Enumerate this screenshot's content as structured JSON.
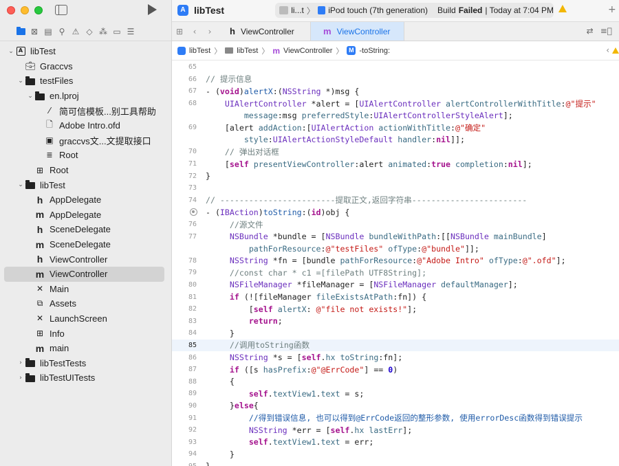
{
  "window": {
    "app_title": "libTest",
    "scheme": "li...t",
    "device": "iPod touch (7th generation)",
    "build_label": "Build",
    "build_status": "Failed",
    "build_time": "| Today at 7:04 PM"
  },
  "sidebar": {
    "tree": [
      {
        "label": "libTest",
        "icon": "project-icon",
        "depth": 0,
        "disclosure": "⌄"
      },
      {
        "label": "Graccvs",
        "icon": "briefcase-icon",
        "depth": 1,
        "disclosure": ""
      },
      {
        "label": "testFiles",
        "icon": "folder-icon",
        "depth": 1,
        "disclosure": "⌄"
      },
      {
        "label": "en.lproj",
        "icon": "folder-icon",
        "depth": 2,
        "disclosure": "⌄"
      },
      {
        "label": "简可信模板...别工具帮助",
        "icon": "pen-icon",
        "depth": 3,
        "disclosure": ""
      },
      {
        "label": "Adobe Intro.ofd",
        "icon": "document-icon",
        "depth": 3,
        "disclosure": ""
      },
      {
        "label": "graccvs文...文提取接口",
        "icon": "image-icon",
        "depth": 3,
        "disclosure": ""
      },
      {
        "label": "Root",
        "icon": "strings-icon",
        "depth": 3,
        "disclosure": ""
      },
      {
        "label": "Root",
        "icon": "table-icon",
        "depth": 2,
        "disclosure": ""
      },
      {
        "label": "libTest",
        "icon": "folder-icon",
        "depth": 1,
        "disclosure": "⌄"
      },
      {
        "label": "AppDelegate",
        "icon": "header-icon",
        "depth": 2,
        "disclosure": ""
      },
      {
        "label": "AppDelegate",
        "icon": "implementation-icon",
        "depth": 2,
        "disclosure": ""
      },
      {
        "label": "SceneDelegate",
        "icon": "header-icon",
        "depth": 2,
        "disclosure": ""
      },
      {
        "label": "SceneDelegate",
        "icon": "implementation-icon",
        "depth": 2,
        "disclosure": ""
      },
      {
        "label": "ViewController",
        "icon": "header-icon",
        "depth": 2,
        "disclosure": ""
      },
      {
        "label": "ViewController",
        "icon": "implementation-icon",
        "depth": 2,
        "disclosure": "",
        "selected": true
      },
      {
        "label": "Main",
        "icon": "storyboard-icon",
        "depth": 2,
        "disclosure": ""
      },
      {
        "label": "Assets",
        "icon": "assets-icon",
        "depth": 2,
        "disclosure": ""
      },
      {
        "label": "LaunchScreen",
        "icon": "storyboard-icon",
        "depth": 2,
        "disclosure": ""
      },
      {
        "label": "Info",
        "icon": "table-icon",
        "depth": 2,
        "disclosure": ""
      },
      {
        "label": "main",
        "icon": "implementation-icon",
        "depth": 2,
        "disclosure": ""
      },
      {
        "label": "libTestTests",
        "icon": "folder-icon",
        "depth": 1,
        "disclosure": "›"
      },
      {
        "label": "libTestUITests",
        "icon": "folder-icon",
        "depth": 1,
        "disclosure": "›"
      }
    ]
  },
  "tabs": [
    {
      "kind": "h",
      "label": "ViewController",
      "active": false
    },
    {
      "kind": "m",
      "label": "ViewController",
      "active": true
    }
  ],
  "breadcrumb": {
    "project": "libTest",
    "group": "libTest",
    "file": "ViewController",
    "symbol": "-toString:"
  },
  "editor": {
    "current_line": 85,
    "lines": [
      {
        "n": "65",
        "html": ""
      },
      {
        "n": "66",
        "html": "<span class='cm'>// 提示信息</span>"
      },
      {
        "n": "67",
        "html": "- (<span class='kw'>void</span>)<span class='mc'>alertX</span>:(<span class='ty'>NSString</span> *)msg {"
      },
      {
        "n": "68",
        "html": "    <span class='ty'>UIAlertController</span> *alert = [<span class='ty'>UIAlertController</span> <span class='me'>alertControllerWithTitle</span>:<span class='st'>@\"提示\"</span>"
      },
      {
        "n": "",
        "html": "        <span class='me'>message</span>:msg <span class='me'>preferredStyle</span>:<span class='ty'>UIAlertControllerStyleAlert</span>];"
      },
      {
        "n": "69",
        "html": "    [alert <span class='me'>addAction</span>:[<span class='ty'>UIAlertAction</span> <span class='me'>actionWithTitle</span>:<span class='st'>@\"确定\"</span>"
      },
      {
        "n": "",
        "html": "        <span class='me'>style</span>:<span class='ty'>UIAlertActionStyleDefault</span> <span class='me'>handler</span>:<span class='kw'>nil</span>]];"
      },
      {
        "n": "70",
        "html": "    <span class='cm'>// 弹出对话框</span>"
      },
      {
        "n": "71",
        "html": "    [<span class='kw'>self</span> <span class='me'>presentViewController</span>:alert <span class='me'>animated</span>:<span class='kw'>true</span> <span class='me'>completion</span>:<span class='kw'>nil</span>];"
      },
      {
        "n": "72",
        "html": "}"
      },
      {
        "n": "73",
        "html": ""
      },
      {
        "n": "74",
        "html": "<span class='cm'>// ------------------------提取正文,返回字符串------------------------</span>"
      },
      {
        "n": "75",
        "html": "- (<span class='pp'>IBAction</span>)<span class='mc'>toString</span>:(<span class='kw'>id</span>)obj {",
        "breakpoint": true
      },
      {
        "n": "76",
        "html": "     <span class='cm'>//源文件</span>"
      },
      {
        "n": "77",
        "html": "     <span class='ty'>NSBundle</span> *bundle = [<span class='ty'>NSBundle</span> <span class='me'>bundleWithPath</span>:[[<span class='ty'>NSBundle</span> <span class='me'>mainBundle</span>]"
      },
      {
        "n": "",
        "html": "         <span class='me'>pathForResource</span>:<span class='st'>@\"testFiles\"</span> <span class='me'>ofType</span>:<span class='st'>@\"bundle\"</span>]];"
      },
      {
        "n": "78",
        "html": "     <span class='ty'>NSString</span> *fn = [bundle <span class='me'>pathForResource</span>:<span class='st'>@\"Adobe Intro\"</span> <span class='me'>ofType</span>:<span class='st'>@\".ofd\"</span>];"
      },
      {
        "n": "79",
        "html": "     <span class='cm'>//const char * c1 =[filePath UTF8String];</span>"
      },
      {
        "n": "80",
        "html": "     <span class='ty'>NSFileManager</span> *fileManager = [<span class='ty'>NSFileManager</span> <span class='me'>defaultManager</span>];"
      },
      {
        "n": "81",
        "html": "     <span class='kw'>if</span> (![fileManager <span class='me'>fileExistsAtPath</span>:fn]) {"
      },
      {
        "n": "82",
        "html": "         [<span class='kw'>self</span> <span class='me'>alertX</span>: <span class='st'>@\"file not exists!\"</span>];"
      },
      {
        "n": "83",
        "html": "         <span class='kw'>return</span>;"
      },
      {
        "n": "84",
        "html": "     }"
      },
      {
        "n": "85",
        "html": "     <span class='cm'>//调用toString函数</span>"
      },
      {
        "n": "86",
        "html": "     <span class='ty'>NSString</span> *s = [<span class='kw'>self</span>.<span class='me'>hx</span> <span class='me'>toString</span>:fn];"
      },
      {
        "n": "87",
        "html": "     <span class='kw'>if</span> ([s <span class='me'>hasPrefix</span>:<span class='st'>@\"@ErrCode\"</span>] == <span class='nu'>0</span>)"
      },
      {
        "n": "88",
        "html": "     {"
      },
      {
        "n": "89",
        "html": "         <span class='kw'>self</span>.<span class='me'>textView1</span>.<span class='me'>text</span> = s;"
      },
      {
        "n": "90",
        "html": "     }<span class='kw'>else</span>{"
      },
      {
        "n": "91",
        "html": "         <span class='mc'>//得到错误信息, 也可以得到@ErrCode返回的整形参数, 使用errorDesc函数得到错误提示</span>"
      },
      {
        "n": "92",
        "html": "         <span class='ty'>NSString</span> *err = [<span class='kw'>self</span>.<span class='me'>hx</span> <span class='me'>lastErr</span>];"
      },
      {
        "n": "93",
        "html": "         <span class='kw'>self</span>.<span class='me'>textView1</span>.<span class='me'>text</span> = err;"
      },
      {
        "n": "94",
        "html": "     }"
      },
      {
        "n": "95",
        "html": "}"
      },
      {
        "n": "96",
        "html": ""
      }
    ]
  }
}
